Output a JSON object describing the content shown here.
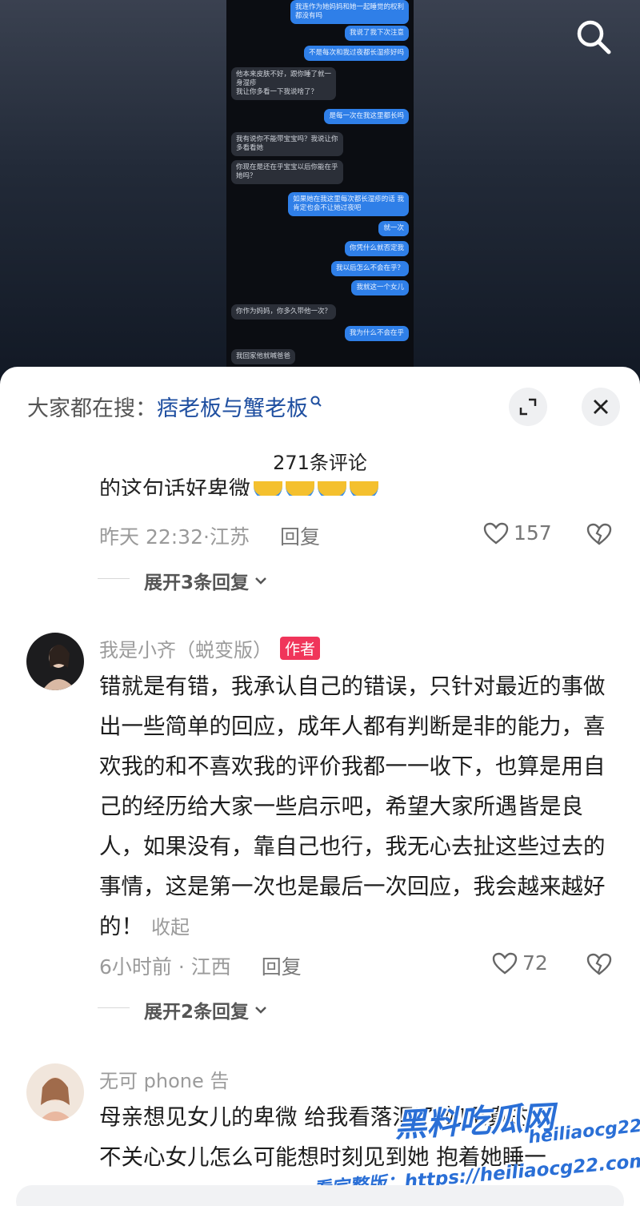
{
  "video": {
    "chat": [
      {
        "side": "r",
        "text": "我连作为她妈妈和她一起睡觉的权利\n都没有吗"
      },
      {
        "side": "r",
        "text": "我说了我下次注意"
      },
      {
        "side": "r",
        "text": "不是每次和我过夜都长湿疹好吗"
      },
      {
        "side": "l",
        "text": "他本来皮肤不好，跟你睡了就一\n身湿疹\n我让你多看一下我说啥了？"
      },
      {
        "side": "r",
        "text": "是每一次在我这里都长吗"
      },
      {
        "side": "l",
        "text": "我有说你不能带宝宝吗？我说让你\n多看看她"
      },
      {
        "side": "l",
        "text": "你现在是还在乎宝宝以后你能在乎\n她吗？"
      },
      {
        "side": "r",
        "text": "如果她在我这里每次都长湿疹的话 我\n肯定也会不让她过夜吧"
      },
      {
        "side": "r",
        "text": "就一次"
      },
      {
        "side": "r",
        "text": "你凭什么就否定我"
      },
      {
        "side": "r",
        "text": "我以后怎么不会在乎？"
      },
      {
        "side": "r",
        "text": "我就这一个女儿"
      },
      {
        "side": "l",
        "text": "你作为妈妈，你多久带他一次？"
      },
      {
        "side": "r",
        "text": "我为什么不会在乎"
      },
      {
        "side": "l",
        "text": "我回家他就喊爸爸"
      }
    ],
    "search_icon": "search-icon"
  },
  "header": {
    "hot_prefix": "大家都在搜：",
    "hot_keyword": "痞老板与蟹老板",
    "expand_icon": "expand-icon",
    "close_icon": "close-icon"
  },
  "comment_count": "271条评论",
  "comments": [
    {
      "text_partial": "的这句话好卑微",
      "time": "昨天 22:32·江苏",
      "reply": "回复",
      "likes": "157",
      "expand": "展开3条回复"
    },
    {
      "user": "我是小齐（蜕变版）",
      "badge": "作者",
      "text": "错就是有错，我承认自己的错误，只针对最近的事做出一些简单的回应，成年人都有判断是非的能力，喜欢我的和不喜欢我的评价我都一一收下，也算是用自己的经历给大家一些启示吧，希望大家所遇皆是良人，如果没有，靠自己也行，我无心去扯这些过去的事情，这是第一次也是最后一次回应，我会越来越好的！",
      "fold": "收起",
      "time": "6小时前 · 江西",
      "reply": "回复",
      "likes": "72",
      "expand": "展开2条回复"
    },
    {
      "user": "无可 phone 告",
      "line1": "母亲想见女儿的卑微 给我看落泪了 如果真的",
      "line2": "不关心女儿怎么可能想时刻见到她 抱着她睡一"
    }
  ],
  "watermark": {
    "brand": "黑料吃瓜网",
    "url": "heiliaocg22.com",
    "line2": "看完整版：https://heiliaocg22.com"
  },
  "colors": {
    "accent": "#f0355a",
    "keyword": "#1f4fa0",
    "bubble_blue": "#2f7fe8"
  }
}
